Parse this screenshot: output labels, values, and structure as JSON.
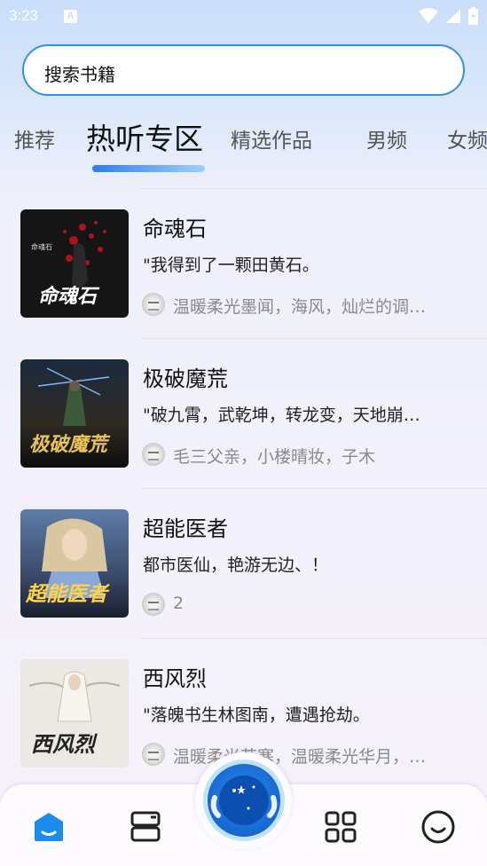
{
  "status_bar": {
    "time": "3:23",
    "a_icon": "A"
  },
  "search": {
    "placeholder": "搜索书籍"
  },
  "tabs": [
    {
      "label": "推荐",
      "active": false
    },
    {
      "label": "热听专区",
      "active": true
    },
    {
      "label": "精选作品",
      "active": false
    },
    {
      "label": "男频",
      "active": false
    },
    {
      "label": "女频",
      "active": false
    }
  ],
  "books": [
    {
      "title": "命魂石",
      "desc": "\"我得到了一颗田黄石。",
      "author": "温暖柔光墨闻，海风，灿烂的调…",
      "cover_text": "命魂石"
    },
    {
      "title": "极破魔荒",
      "desc": "\"破九霄，武乾坤，转龙变，天地崩…",
      "author": "毛三父亲，小楼晴妆，子木",
      "cover_text": "极破魔荒"
    },
    {
      "title": "超能医者",
      "desc": "都市医仙，艳游无边、！",
      "author": "2",
      "cover_text": "超能医者"
    },
    {
      "title": "西风烈",
      "desc": "\"落魄书生林图南，遭遇抢劫。",
      "author": "温暖柔光若寒，温暖柔光华月，…",
      "cover_text": "西风烈"
    }
  ],
  "bottom_nav": {
    "items": [
      "home-icon",
      "bookshelf-icon",
      "player-icon",
      "category-icon",
      "profile-icon"
    ],
    "active": "home-icon"
  },
  "colors": {
    "accent": "#2d93e6",
    "nav_active": "#1a8cf0"
  }
}
